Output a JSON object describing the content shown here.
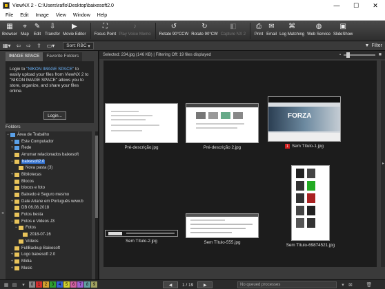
{
  "window": {
    "title": "ViewNX 2 - C:\\Users\\raflo\\Desktop\\baixesoft2.0",
    "minimize": "—",
    "maximize": "☐",
    "close": "✕"
  },
  "menu": [
    "File",
    "Edit",
    "Image",
    "View",
    "Window",
    "Help"
  ],
  "toolbar": [
    {
      "label": "Browser",
      "icon": "browser-icon",
      "glyph": "▦",
      "enabled": true
    },
    {
      "label": "Map",
      "icon": "map-icon",
      "glyph": "⌖",
      "enabled": true
    },
    {
      "label": "Edit",
      "icon": "edit-icon",
      "glyph": "✎",
      "enabled": true
    },
    {
      "label": "Transfer",
      "icon": "transfer-icon",
      "glyph": "⇩",
      "enabled": true
    },
    {
      "label": "Movie Editor",
      "icon": "movie-editor-icon",
      "glyph": "▶",
      "enabled": true
    },
    {
      "label": "Focus Point",
      "icon": "focus-point-icon",
      "glyph": "⛶",
      "enabled": true
    },
    {
      "label": "Play Voice Memo",
      "icon": "voice-memo-icon",
      "glyph": "♪",
      "enabled": false
    },
    {
      "label": "Rotate 90°CCW",
      "icon": "rotate-ccw-icon",
      "glyph": "↺",
      "enabled": true
    },
    {
      "label": "Rotate 90°CW",
      "icon": "rotate-cw-icon",
      "glyph": "↻",
      "enabled": true
    },
    {
      "label": "Capture NX 2",
      "icon": "capture-nx-icon",
      "glyph": "◧",
      "enabled": false
    },
    {
      "label": "Print",
      "icon": "print-icon",
      "glyph": "⎙",
      "enabled": true
    },
    {
      "label": "Email",
      "icon": "email-icon",
      "glyph": "✉",
      "enabled": true
    },
    {
      "label": "Log Matching",
      "icon": "log-matching-icon",
      "glyph": "⌘",
      "enabled": true
    },
    {
      "label": "Web Service",
      "icon": "web-service-icon",
      "glyph": "◍",
      "enabled": true
    },
    {
      "label": "SlideShow",
      "icon": "slideshow-icon",
      "glyph": "▣",
      "enabled": true
    }
  ],
  "subbar": {
    "sort_label": "Sort: RBC",
    "filter_label": "Filter"
  },
  "left_panel": {
    "tabs": [
      "IMAGE SPACE",
      "Favorite Folders"
    ],
    "nis_text_before": "Login to ",
    "nis_link": "\"NIKON IMAGE SPACE\"",
    "nis_text_after": " to easily upload your files from ViewNX 2 to \"NIKON IMAGE SPACE\" allows you to store, organize, and share your files online.",
    "login_label": "Login...",
    "folders_heading": "Folders",
    "folders": [
      {
        "label": "Área de Trabalho",
        "level": 0,
        "exp": "−",
        "color": "blue",
        "selected": false
      },
      {
        "label": "Este Computador",
        "level": 1,
        "exp": "+",
        "color": "blue",
        "selected": false
      },
      {
        "label": "Rede",
        "level": 1,
        "exp": "+",
        "color": "blue",
        "selected": false
      },
      {
        "label": "Arrumar relacionados baixesoft",
        "level": 1,
        "exp": "",
        "color": "yellow",
        "selected": false
      },
      {
        "label": "baixesoft2.0",
        "level": 1,
        "exp": "−",
        "color": "yellow",
        "selected": true
      },
      {
        "label": "Nova pasta (3)",
        "level": 2,
        "exp": "",
        "color": "yellow",
        "selected": false
      },
      {
        "label": "Bibliotecas",
        "level": 1,
        "exp": "+",
        "color": "yellow",
        "selected": false
      },
      {
        "label": "Blocos",
        "level": 1,
        "exp": "",
        "color": "yellow",
        "selected": false
      },
      {
        "label": "blocos e foto",
        "level": 1,
        "exp": "",
        "color": "yellow",
        "selected": false
      },
      {
        "label": "Baixedo é Seguro mesmo",
        "level": 1,
        "exp": "",
        "color": "yellow",
        "selected": false
      },
      {
        "label": "Date Ariane em Português www.b",
        "level": 1,
        "exp": "+",
        "color": "yellow",
        "selected": false
      },
      {
        "label": "DB 06.08.2018",
        "level": 1,
        "exp": "",
        "color": "yellow",
        "selected": false
      },
      {
        "label": "Fotos besta",
        "level": 1,
        "exp": "",
        "color": "yellow",
        "selected": false
      },
      {
        "label": "Fotos e Videos J3",
        "level": 1,
        "exp": "−",
        "color": "yellow",
        "selected": false
      },
      {
        "label": "Fotos",
        "level": 2,
        "exp": "−",
        "color": "yellow",
        "selected": false
      },
      {
        "label": "2018-07-16",
        "level": 3,
        "exp": "",
        "color": "yellow",
        "selected": false
      },
      {
        "label": "Vídeos",
        "level": 2,
        "exp": "",
        "color": "yellow",
        "selected": false
      },
      {
        "label": "FullBackup Baixesoft",
        "level": 1,
        "exp": "",
        "color": "yellow",
        "selected": false
      },
      {
        "label": "Logo baixesoft 2.0",
        "level": 1,
        "exp": "+",
        "color": "yellow",
        "selected": false
      },
      {
        "label": "Mídia",
        "level": 1,
        "exp": "+",
        "color": "yellow",
        "selected": false
      },
      {
        "label": "Music",
        "level": 1,
        "exp": "+",
        "color": "yellow",
        "selected": false
      }
    ]
  },
  "main": {
    "info": "Selected: 234.jpg (146 KB) | Filtering Off: 19 files displayed",
    "thumbnails": [
      {
        "caption": "Pré-descrição.jpg",
        "badge": ""
      },
      {
        "caption": "Pré-descrição 2.jpg",
        "badge": ""
      },
      {
        "caption": "Sem Título-1.jpg",
        "badge": "1"
      },
      {
        "caption": "Sem Título-2.jpg",
        "badge": ""
      },
      {
        "caption": "Sem Título-555.jpg",
        "badge": ""
      },
      {
        "caption": "Sem Título-69874521.jpg",
        "badge": ""
      }
    ]
  },
  "bottom": {
    "labels": [
      {
        "n": "0",
        "color": "#888888"
      },
      {
        "n": "1",
        "color": "#d03030"
      },
      {
        "n": "2",
        "color": "#d0a030"
      },
      {
        "n": "3",
        "color": "#30a030"
      },
      {
        "n": "4",
        "color": "#3060d0"
      },
      {
        "n": "5",
        "color": "#d0d030"
      },
      {
        "n": "6",
        "color": "#d060a0"
      },
      {
        "n": "7",
        "color": "#a060d0"
      },
      {
        "n": "8",
        "color": "#60a0a0"
      },
      {
        "n": "9",
        "color": "#a0a060"
      }
    ],
    "page_text": "1 / 19",
    "queue_text": "No queued processes"
  }
}
